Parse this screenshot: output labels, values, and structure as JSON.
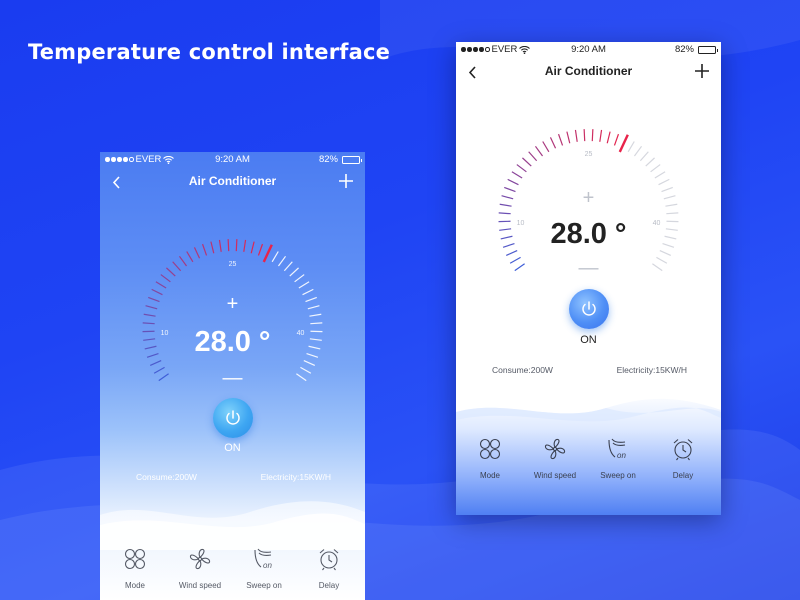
{
  "page_title": "Temperature control interface",
  "colors": {
    "accent_red": "#e8234a",
    "cold_blue": "#3f5fd8",
    "tick_light": "#d5d7de",
    "background": "#1f44f4"
  },
  "phones": [
    {
      "variant": "blue",
      "status": {
        "carrier": "EVER",
        "time": "9:20 AM",
        "battery": "82%",
        "battery_level": 0.82
      },
      "nav": {
        "back_icon": "chevron-left-icon",
        "title": "Air Conditioner",
        "add_icon": "plus-icon"
      },
      "dial": {
        "label_min": "10",
        "label_mid": "25",
        "label_max": "40",
        "setpoint": 28.0
      },
      "temperature": {
        "plus": "+",
        "value": "28.0 °",
        "minus": "—"
      },
      "power": {
        "icon": "power-icon",
        "label": "ON"
      },
      "stats": {
        "consume": "Consume:200W",
        "electricity": "Electricity:15KW/H"
      },
      "controls": [
        {
          "icon": "mode-icon",
          "label": "Mode"
        },
        {
          "icon": "fan-icon",
          "label": "Wind speed"
        },
        {
          "icon": "sweep-icon",
          "label": "Sweep on"
        },
        {
          "icon": "alarm-clock-icon",
          "label": "Delay"
        }
      ]
    },
    {
      "variant": "white",
      "status": {
        "carrier": "EVER",
        "time": "9:20 AM",
        "battery": "82%",
        "battery_level": 0.82
      },
      "nav": {
        "back_icon": "chevron-left-icon",
        "title": "Air Conditioner",
        "add_icon": "plus-icon"
      },
      "dial": {
        "label_min": "10",
        "label_mid": "25",
        "label_max": "40",
        "setpoint": 28.0
      },
      "temperature": {
        "plus": "+",
        "value": "28.0 °",
        "minus": "—"
      },
      "power": {
        "icon": "power-icon",
        "label": "ON"
      },
      "stats": {
        "consume": "Consume:200W",
        "electricity": "Electricity:15KW/H"
      },
      "controls": [
        {
          "icon": "mode-icon",
          "label": "Mode"
        },
        {
          "icon": "fan-icon",
          "label": "Wind speed"
        },
        {
          "icon": "sweep-icon",
          "label": "Sweep on"
        },
        {
          "icon": "alarm-clock-icon",
          "label": "Delay"
        }
      ]
    }
  ]
}
